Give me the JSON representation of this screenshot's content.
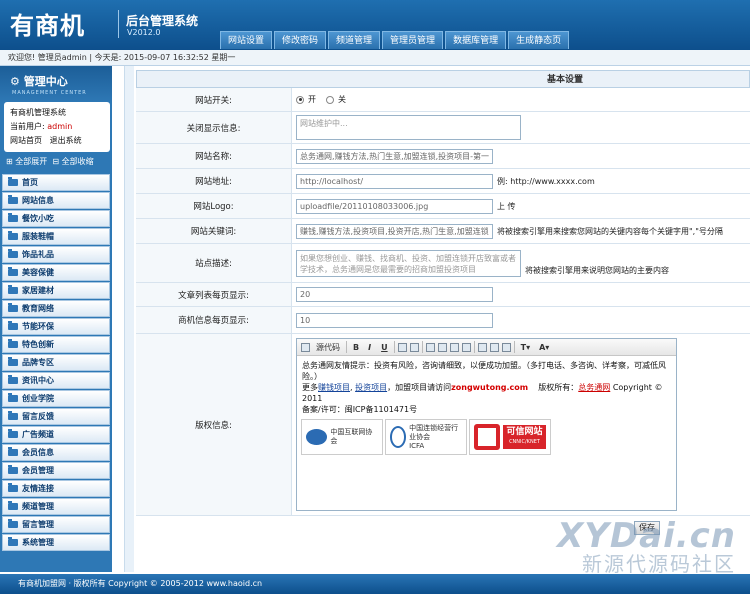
{
  "header": {
    "logo": "有商机",
    "system_name": "后台管理系统",
    "version": "V2012.0",
    "tabs": [
      "网站设置",
      "修改密码",
      "频道管理",
      "管理员管理",
      "数据库管理",
      "生成静态页"
    ]
  },
  "infobar": {
    "text": "欢迎您! 管理员admin | 今天是: 2015-09-07 16:32:52 星期一"
  },
  "sidebar": {
    "title": "管理中心",
    "subtitle": "MANAGEMENT CENTER",
    "site_name": "有商机管理系统",
    "current_user_label": "当前用户:",
    "current_user": "admin",
    "home_link": "网站首页",
    "logout_link": "退出系统",
    "expand_all": "全部展开",
    "collapse_all": "全部收缩",
    "menu": [
      "首页",
      "网站信息",
      "餐饮小吃",
      "服装鞋帽",
      "饰品礼品",
      "美容保健",
      "家居建材",
      "教育网络",
      "节能环保",
      "特色创新",
      "品牌专区",
      "资讯中心",
      "创业学院",
      "留言反馈",
      "广告频道",
      "会员信息",
      "会员管理",
      "友情连接",
      "频道管理",
      "留言管理",
      "系统管理"
    ]
  },
  "form": {
    "title": "基本设置",
    "site_open": {
      "label": "网站开关:",
      "on": "开",
      "off": "关"
    },
    "close_msg": {
      "label": "关闭显示信息:",
      "placeholder": "网站维护中..."
    },
    "site_name": {
      "label": "网站名称:",
      "value": "总务通网,赚钱方法,热门生意,加盟连锁,投资项目-第一"
    },
    "site_url": {
      "label": "网站地址:",
      "value": "http://localhost/",
      "hint": "例: http://www.xxxx.com"
    },
    "site_logo": {
      "label": "网站Logo:",
      "value": "uploadfile/20110108033006.jpg",
      "upload": "上 传"
    },
    "keywords": {
      "label": "网站关键词:",
      "value": "赚钱,赚钱方法,投资项目,投资开店,热门生意,加盟连锁",
      "hint": "将被搜索引擎用来搜索您网站的关键内容每个关键字用\",\"号分隔"
    },
    "description": {
      "label": "站点描述:",
      "value": "如果您想创业、赚钱、找商机、投资、加盟连锁开店致富或者学技术，总务通网是您最需要的招商加盟投资项目",
      "hint": "将被搜索引擎用来说明您网站的主要内容"
    },
    "article_per_page": {
      "label": "文章列表每页显示:",
      "value": "20"
    },
    "biz_per_page": {
      "label": "商机信息每页显示:",
      "value": "10"
    },
    "copyright": {
      "label": "版权信息:",
      "toolbar_source": "源代码",
      "line1": "总务通网友情提示：投资有风险，咨询请细致，以便成功加盟。（多打电话、多咨询、详考察，可减低风险。）",
      "more": "更多",
      "link1": "赚钱项目",
      "link2": "投资项目",
      "join_text": "，加盟项目请访问",
      "domain": "zongwutong.com",
      "rights": "版权所有：",
      "owner": "总务通网",
      "copy_year": "Copyright © 2011",
      "icp": "备案/许可：闽ICP备1101471号",
      "logo1_text": "中国互联网协会",
      "logo2_text": "中国连锁经营行业协会",
      "logo2_abbr": "ICFA",
      "logo3_title": "可信网站",
      "logo3_sub": "CNNIC/KNET"
    }
  },
  "save_button": "保存",
  "footer": "有商机加盟网 · 版权所有 Copyright © 2005-2012 www.haoid.cn",
  "watermark": {
    "line1": "XYDai.cn",
    "line2": "新源代源码社区"
  }
}
